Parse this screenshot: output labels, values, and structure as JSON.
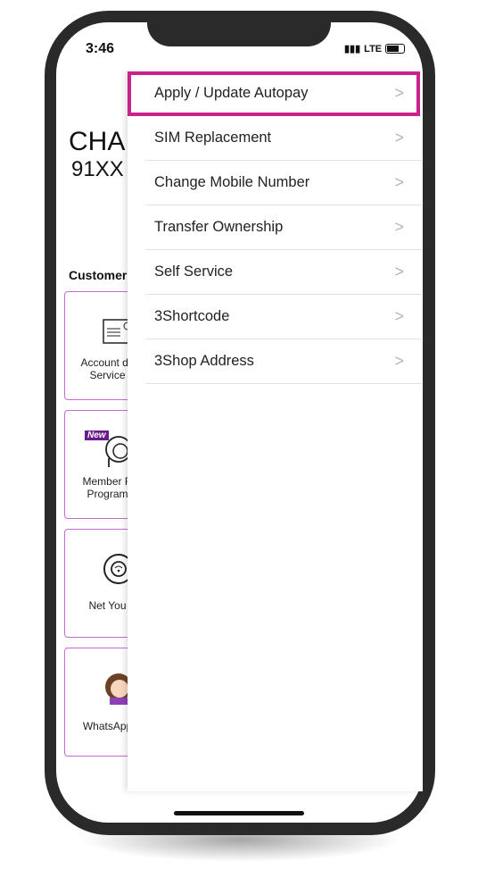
{
  "status_bar": {
    "time": "3:46",
    "network": "LTE"
  },
  "background": {
    "name_partial": "CHA",
    "number_partial": "91XX",
    "section_title": "Customer",
    "cards": [
      {
        "label": "Account de\nService",
        "icon": "account-card-icon"
      },
      {
        "label": "Member R\nProgram",
        "icon": "member-rewards-icon",
        "badge": "New"
      },
      {
        "label": "Net You",
        "icon": "wifi-search-icon"
      },
      {
        "label": "WhatsApp",
        "icon": "avatar-icon"
      }
    ]
  },
  "menu": {
    "items": [
      {
        "label": "Apply / Update Autopay",
        "highlighted": true
      },
      {
        "label": "SIM Replacement"
      },
      {
        "label": "Change Mobile Number"
      },
      {
        "label": "Transfer Ownership"
      },
      {
        "label": "Self Service"
      },
      {
        "label": "3Shortcode"
      },
      {
        "label": "3Shop Address"
      }
    ],
    "chevron": ">"
  },
  "colors": {
    "highlight": "#c8238a",
    "card_border": "#c46fd0"
  }
}
